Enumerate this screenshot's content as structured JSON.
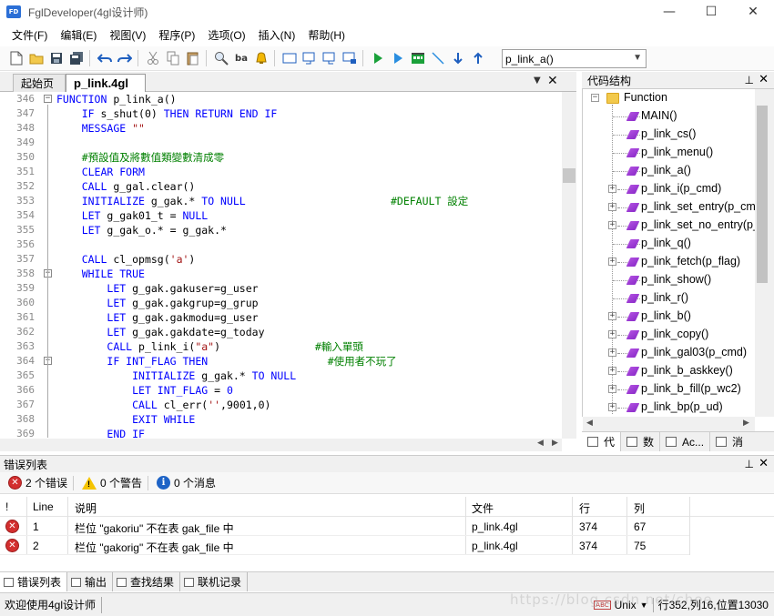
{
  "window": {
    "title": "FglDeveloper(4gl设计师)",
    "icon_text": "FD",
    "controls": [
      "—",
      "☐",
      "✕"
    ]
  },
  "menu": [
    "文件(F)",
    "编辑(E)",
    "视图(V)",
    "程序(P)",
    "选项(O)",
    "插入(N)",
    "帮助(H)"
  ],
  "toolbar": {
    "function_combo_value": "p_link_a()"
  },
  "editor": {
    "tabs": [
      {
        "label": "起始页",
        "active": false
      },
      {
        "label": "p_link.4gl",
        "active": true
      }
    ],
    "lines": [
      {
        "n": "346",
        "fold": "minus",
        "parts": [
          [
            "kw",
            "FUNCTION "
          ],
          [
            "tx",
            "p_link_a()"
          ]
        ]
      },
      {
        "n": "347",
        "parts": [
          [
            "tx",
            "    "
          ],
          [
            "kw",
            "IF "
          ],
          [
            "tx",
            "s_shut(0) "
          ],
          [
            "kw",
            "THEN RETURN END IF"
          ]
        ]
      },
      {
        "n": "348",
        "parts": [
          [
            "tx",
            "    "
          ],
          [
            "kw",
            "MESSAGE "
          ],
          [
            "st",
            "\"\""
          ]
        ]
      },
      {
        "n": "349",
        "parts": []
      },
      {
        "n": "350",
        "parts": [
          [
            "tx",
            "    "
          ],
          [
            "cm",
            "#預設值及將數值類變數清成零"
          ]
        ]
      },
      {
        "n": "351",
        "parts": [
          [
            "tx",
            "    "
          ],
          [
            "kw",
            "CLEAR FORM"
          ]
        ]
      },
      {
        "n": "352",
        "parts": [
          [
            "tx",
            "    "
          ],
          [
            "kw",
            "CALL "
          ],
          [
            "tx",
            "g_gal.clear()"
          ]
        ]
      },
      {
        "n": "353",
        "parts": [
          [
            "tx",
            "    "
          ],
          [
            "kw",
            "INITIALIZE "
          ],
          [
            "tx",
            "g_gak.* "
          ],
          [
            "kw",
            "TO NULL"
          ],
          [
            "tx",
            "                       "
          ],
          [
            "cm",
            "#DEFAULT 設定"
          ]
        ]
      },
      {
        "n": "354",
        "parts": [
          [
            "tx",
            "    "
          ],
          [
            "kw",
            "LET "
          ],
          [
            "tx",
            "g_gak01_t = "
          ],
          [
            "kw",
            "NULL"
          ]
        ]
      },
      {
        "n": "355",
        "parts": [
          [
            "tx",
            "    "
          ],
          [
            "kw",
            "LET "
          ],
          [
            "tx",
            "g_gak_o.* = g_gak.*"
          ]
        ]
      },
      {
        "n": "356",
        "parts": []
      },
      {
        "n": "357",
        "parts": [
          [
            "tx",
            "    "
          ],
          [
            "kw",
            "CALL "
          ],
          [
            "tx",
            "cl_opmsg("
          ],
          [
            "st",
            "'a'"
          ],
          [
            "tx",
            ")"
          ]
        ]
      },
      {
        "n": "358",
        "fold": "minus",
        "parts": [
          [
            "tx",
            "    "
          ],
          [
            "kw",
            "WHILE TRUE"
          ]
        ]
      },
      {
        "n": "359",
        "parts": [
          [
            "tx",
            "        "
          ],
          [
            "kw",
            "LET "
          ],
          [
            "tx",
            "g_gak.gakuser=g_user"
          ]
        ]
      },
      {
        "n": "360",
        "parts": [
          [
            "tx",
            "        "
          ],
          [
            "kw",
            "LET "
          ],
          [
            "tx",
            "g_gak.gakgrup=g_grup"
          ]
        ]
      },
      {
        "n": "361",
        "parts": [
          [
            "tx",
            "        "
          ],
          [
            "kw",
            "LET "
          ],
          [
            "tx",
            "g_gak.gakmodu=g_user"
          ]
        ]
      },
      {
        "n": "362",
        "parts": [
          [
            "tx",
            "        "
          ],
          [
            "kw",
            "LET "
          ],
          [
            "tx",
            "g_gak.gakdate=g_today"
          ]
        ]
      },
      {
        "n": "363",
        "parts": [
          [
            "tx",
            "        "
          ],
          [
            "kw",
            "CALL "
          ],
          [
            "tx",
            "p_link_i("
          ],
          [
            "st",
            "\"a\""
          ],
          [
            "tx",
            ")               "
          ],
          [
            "cm",
            "#輸入單頭"
          ]
        ]
      },
      {
        "n": "364",
        "fold": "minus",
        "parts": [
          [
            "tx",
            "        "
          ],
          [
            "kw",
            "IF INT_FLAG THEN"
          ],
          [
            "tx",
            "                   "
          ],
          [
            "cm",
            "#使用者不玩了"
          ]
        ]
      },
      {
        "n": "365",
        "parts": [
          [
            "tx",
            "            "
          ],
          [
            "kw",
            "INITIALIZE "
          ],
          [
            "tx",
            "g_gak.* "
          ],
          [
            "kw",
            "TO NULL"
          ]
        ]
      },
      {
        "n": "366",
        "parts": [
          [
            "tx",
            "            "
          ],
          [
            "kw",
            "LET INT_FLAG "
          ],
          [
            "tx",
            "= "
          ],
          [
            "kw",
            "0"
          ]
        ]
      },
      {
        "n": "367",
        "parts": [
          [
            "tx",
            "            "
          ],
          [
            "kw",
            "CALL "
          ],
          [
            "tx",
            "cl_err("
          ],
          [
            "st",
            "''"
          ],
          [
            "tx",
            ",9001,0)"
          ]
        ]
      },
      {
        "n": "368",
        "parts": [
          [
            "tx",
            "            "
          ],
          [
            "kw",
            "EXIT WHILE"
          ]
        ]
      },
      {
        "n": "369",
        "parts": [
          [
            "tx",
            "        "
          ],
          [
            "kw",
            "END IF"
          ]
        ]
      }
    ]
  },
  "code_structure": {
    "title": "代码结构",
    "root": "Function",
    "items": [
      {
        "label": "MAIN()",
        "expandable": false
      },
      {
        "label": "p_link_cs()",
        "expandable": false
      },
      {
        "label": "p_link_menu()",
        "expandable": false
      },
      {
        "label": "p_link_a()",
        "expandable": false
      },
      {
        "label": "p_link_i(p_cmd)",
        "expandable": true
      },
      {
        "label": "p_link_set_entry(p_cmd)",
        "expandable": true
      },
      {
        "label": "p_link_set_no_entry(p_cmd)",
        "expandable": true
      },
      {
        "label": "p_link_q()",
        "expandable": false
      },
      {
        "label": "p_link_fetch(p_flag)",
        "expandable": true
      },
      {
        "label": "p_link_show()",
        "expandable": false
      },
      {
        "label": "p_link_r()",
        "expandable": false
      },
      {
        "label": "p_link_b()",
        "expandable": true
      },
      {
        "label": "p_link_copy()",
        "expandable": true
      },
      {
        "label": "p_link_gal03(p_cmd)",
        "expandable": true
      },
      {
        "label": "p_link_b_askkey()",
        "expandable": true
      },
      {
        "label": "p_link_b_fill(p_wc2)",
        "expandable": true
      },
      {
        "label": "p_link_bp(p_ud)",
        "expandable": true
      }
    ],
    "tabs": [
      "代",
      "数",
      "Ac...",
      "消"
    ]
  },
  "error_list": {
    "title": "错误列表",
    "filters": {
      "errors": "2 个错误",
      "warnings": "0 个警告",
      "messages": "0 个消息"
    },
    "columns": [
      "!",
      "Line",
      "说明",
      "文件",
      "行",
      "列"
    ],
    "rows": [
      {
        "line": "1",
        "desc": "栏位 \"gakoriu\" 不在表 gak_file 中",
        "file": "p_link.4gl",
        "row": "374",
        "col": "67"
      },
      {
        "line": "2",
        "desc": "栏位 \"gakorig\" 不在表 gak_file 中",
        "file": "p_link.4gl",
        "row": "374",
        "col": "75"
      }
    ]
  },
  "bottom_tabs": [
    "错误列表",
    "输出",
    "查找结果",
    "联机记录"
  ],
  "status": {
    "message": "欢迎使用4gl设计师",
    "encoding_badge": "ABC",
    "line_ending": "Unix",
    "position": "行352,列16,位置13030"
  },
  "watermark": "https://blog.csdn.net/chee"
}
